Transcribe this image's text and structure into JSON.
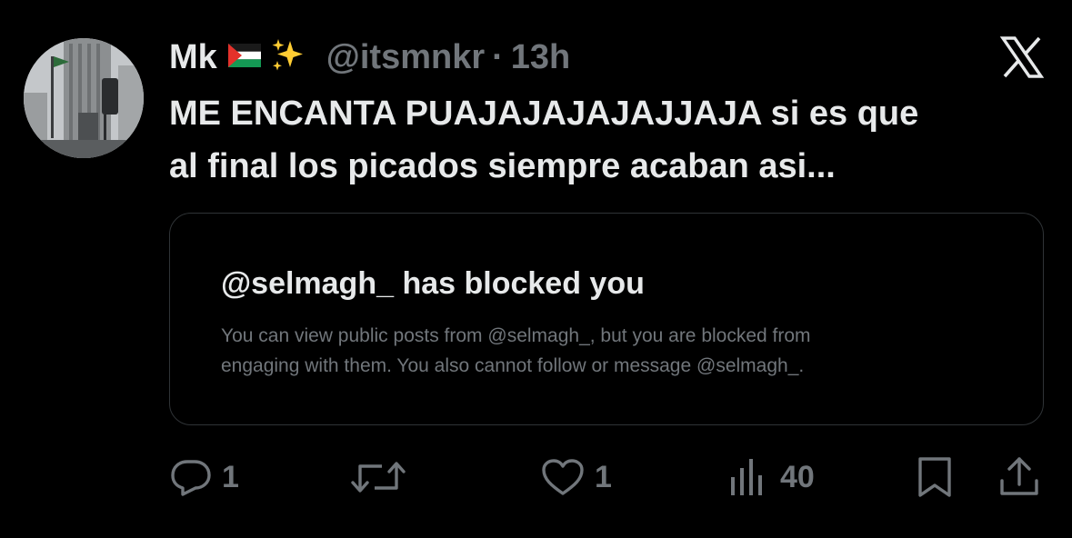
{
  "tweet": {
    "display_name": "Mk",
    "name_emojis": [
      "palestine-flag",
      "sparkles"
    ],
    "handle": "@itsmnkr",
    "separator": "·",
    "time": "13h",
    "text_lines": [
      "ME ENCANTA PUAJAJAJAJAJJAJA si es que",
      "al final los picados siempre acaban asi..."
    ]
  },
  "blocked_card": {
    "title": "@selmagh_ has blocked you",
    "body_lines": [
      "You can view public posts from @selmagh_, but you are blocked from",
      "engaging with them. You also cannot follow or message @selmagh_."
    ]
  },
  "actions": {
    "reply_count": "1",
    "repost_count": "",
    "like_count": "1",
    "views_count": "40"
  },
  "icons": {
    "brand": "x-logo",
    "reply": "reply-icon",
    "repost": "repost-icon",
    "like": "heart-icon",
    "views": "views-icon",
    "bookmark": "bookmark-icon",
    "share": "share-icon"
  },
  "colors": {
    "background": "#000000",
    "primary_text": "#e7e9ea",
    "secondary_text": "#71767b",
    "card_border": "#2f3336"
  }
}
